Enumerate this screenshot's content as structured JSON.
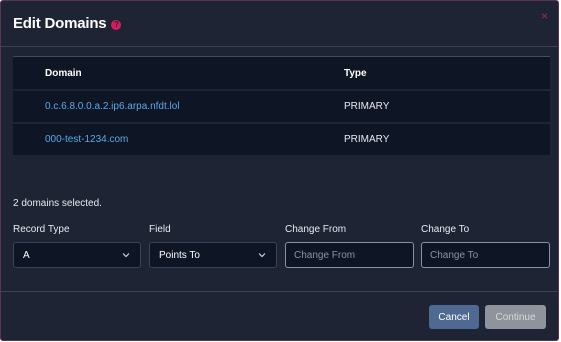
{
  "modal": {
    "title": "Edit Domains",
    "help_icon": "?",
    "close_icon": "×"
  },
  "table": {
    "headers": {
      "domain": "Domain",
      "type": "Type"
    },
    "rows": [
      {
        "domain": "0.c.6.8.0.0.a.2.ip6.arpa.nfdt.lol",
        "type": "PRIMARY"
      },
      {
        "domain": "000-test-1234.com",
        "type": "PRIMARY"
      }
    ]
  },
  "selection": {
    "text": "2 domains selected."
  },
  "form": {
    "record_type": {
      "label": "Record Type",
      "value": "A"
    },
    "field": {
      "label": "Field",
      "value": "Points To"
    },
    "change_from": {
      "label": "Change From",
      "placeholder": "Change From",
      "value": ""
    },
    "change_to": {
      "label": "Change To",
      "placeholder": "Change To",
      "value": ""
    }
  },
  "footer": {
    "cancel_label": "Cancel",
    "continue_label": "Continue"
  },
  "colors": {
    "background": "#1e2434",
    "table_bg": "#0e1525",
    "link": "#5aa9e6",
    "accent_pink": "#d81b60",
    "error_bar": "#c2202f",
    "cancel_button": "#4e6a92",
    "continue_button_disabled": "#8e939c"
  }
}
